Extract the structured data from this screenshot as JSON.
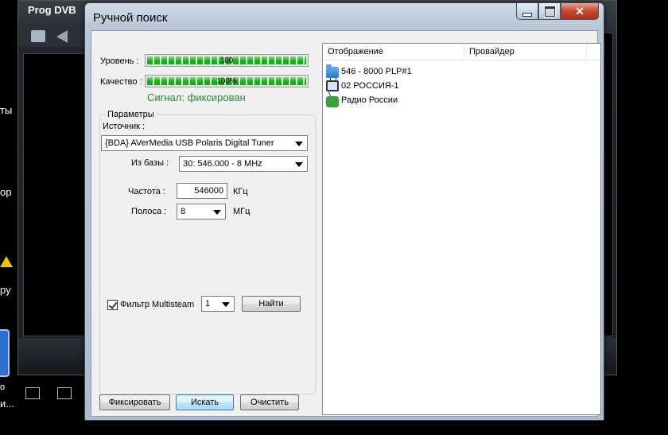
{
  "parent": {
    "title": "Prog DVB",
    "fragments": [
      "ты",
      "ор",
      "ру",
      "о",
      "и..."
    ]
  },
  "dialog": {
    "title": "Ручной поиск",
    "level": {
      "label": "Уровень :",
      "value": "100",
      "fraction": 1.0
    },
    "quality": {
      "label": "Качество :",
      "value": "100%",
      "fraction": 1.0
    },
    "signal": "Сигнал: фиксирован",
    "params": {
      "title": "Параметры",
      "source_label": "Источник :",
      "source_value": "{BDA} AVerMedia USB Polaris Digital Tuner",
      "base_label": "Из базы :",
      "base_value": "30: 546.000 - 8 MHz",
      "freq_label": "Частота :",
      "freq_value": "546000",
      "freq_unit": "КГц",
      "band_label": "Полоса :",
      "band_value": "8",
      "band_unit": "МГц"
    },
    "filter": {
      "label": "Фильтр Multisteam",
      "checked": true,
      "value": "1",
      "find_button": "Найти"
    },
    "buttons": {
      "fix": "Фиксировать",
      "search": "Искать",
      "clear": "Очистить"
    },
    "list": {
      "columns": [
        "Отображение",
        "Провайдер"
      ],
      "rows": [
        {
          "icon": "folder-icon",
          "name": "546 - 8000 PLP#1"
        },
        {
          "icon": "tv-icon",
          "name": "02 РОССИЯ-1"
        },
        {
          "icon": "radio-icon",
          "name": "Радио России"
        }
      ]
    }
  }
}
